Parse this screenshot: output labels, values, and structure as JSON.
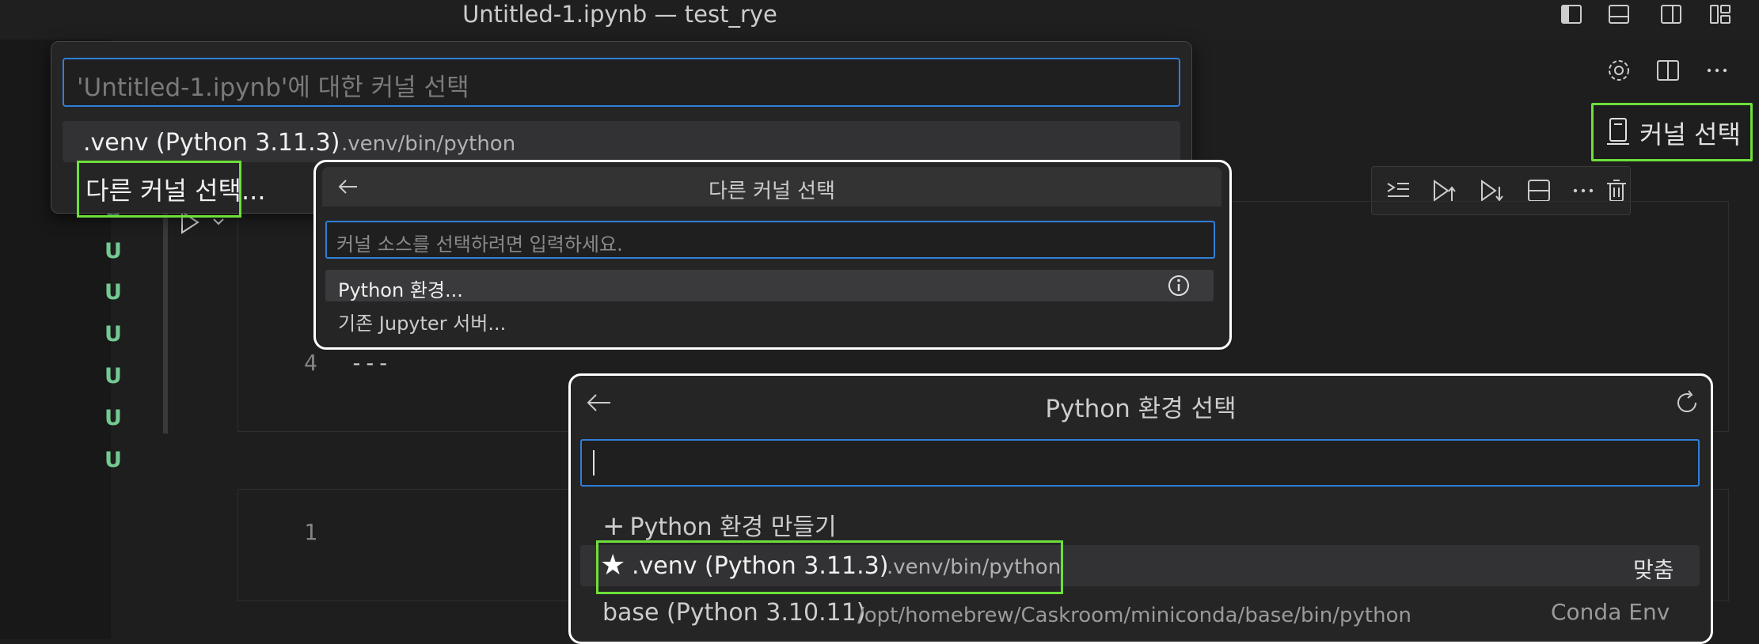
{
  "window": {
    "title": "Untitled-1.ipynb — test_rye"
  },
  "title_bar_icons": [
    "toggle-primary-sidebar-icon",
    "toggle-panel-icon",
    "toggle-secondary-sidebar-icon",
    "customize-layout-icon"
  ],
  "editor_actions": [
    "settings-gear-icon",
    "split-editor-icon",
    "more-actions-icon"
  ],
  "kernel_button": {
    "label": "커널 선택",
    "icon": "server-icon"
  },
  "cell_toolbar": [
    "run-by-line-icon",
    "execute-above-icon",
    "execute-below-icon",
    "split-cell-icon",
    "more-icon",
    "delete-icon"
  ],
  "gutter": {
    "markers": [
      "U",
      "U",
      "U",
      "U",
      "U",
      "U",
      "U"
    ],
    "marker_color": "#73c991"
  },
  "cells": {
    "cell1": {
      "line_number": "4",
      "code": "---"
    },
    "cell2": {
      "line_number": "1"
    }
  },
  "kernel_picker": {
    "placeholder": "'Untitled-1.ipynb'에 대한 커널 선택",
    "items": [
      {
        "label": ".venv (Python 3.11.3)",
        "description": ".venv/bin/python"
      }
    ],
    "other_kernel_label": "다른 커널 선택..."
  },
  "other_kernel_picker": {
    "title": "다른 커널 선택",
    "placeholder": "커널 소스를 선택하려면 입력하세요.",
    "items": [
      {
        "label": "Python 환경...",
        "icon": "info-icon"
      },
      {
        "label": "기존 Jupyter 서버..."
      }
    ]
  },
  "python_env_picker": {
    "title": "Python 환경 선택",
    "input_value": "",
    "create_label": "Python 환경 만들기",
    "items": [
      {
        "label": ".venv (Python 3.11.3)",
        "description": ".venv/bin/python",
        "tag": "맞춤",
        "icon": "star-icon"
      },
      {
        "label": "base (Python 3.10.11)",
        "description": "/opt/homebrew/Caskroom/miniconda/base/bin/python",
        "tag": "Conda Env"
      }
    ]
  },
  "colors": {
    "highlight_box": "#6ddf3a",
    "focus_border": "#2f7fd8",
    "background": "#1e1e1e"
  }
}
